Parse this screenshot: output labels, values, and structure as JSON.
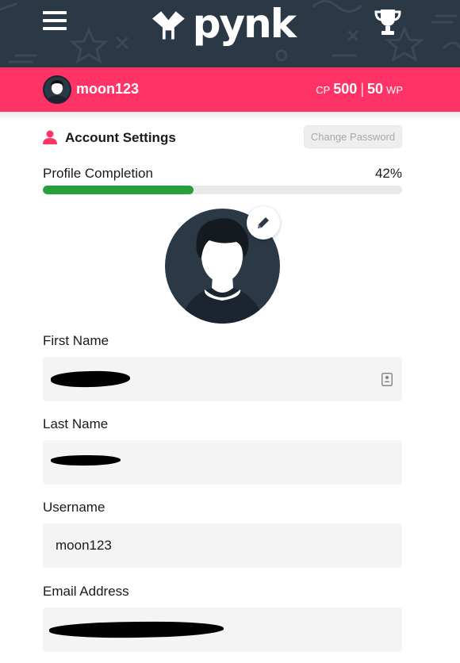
{
  "header": {
    "logo_text": "pynk",
    "icons": {
      "menu": "hamburger-menu-icon",
      "trophy": "trophy-icon",
      "logo_mark": "pynk-logo-mark"
    },
    "colors": {
      "background": "#2b3846",
      "accent": "#ff3366"
    }
  },
  "userbar": {
    "username": "moon123",
    "cp_label": "CP",
    "cp_value": "500",
    "separator": "|",
    "wp_value": "50",
    "wp_label": "WP"
  },
  "account": {
    "title": "Account Settings",
    "change_password_label": "Change Password",
    "completion_label": "Profile Completion",
    "completion_text": "42%",
    "completion_fraction": 0.42,
    "progress_color": "#27a039"
  },
  "form": {
    "first_name": {
      "label": "First Name",
      "value": ""
    },
    "last_name": {
      "label": "Last Name",
      "value": ""
    },
    "username": {
      "label": "Username",
      "value": "moon123"
    },
    "email": {
      "label": "Email Address",
      "value": ""
    }
  }
}
